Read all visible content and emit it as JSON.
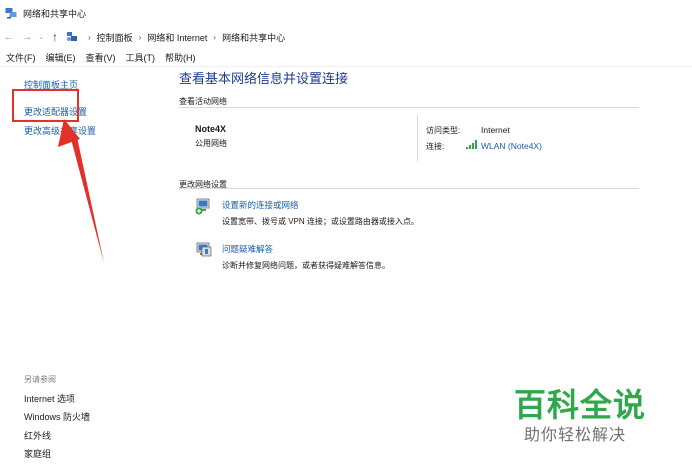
{
  "window": {
    "title": "网络和共享中心",
    "icon": "network-sharing-icon"
  },
  "address": {
    "back_icon": "back-arrow-icon",
    "forward_icon": "forward-arrow-icon",
    "history_icon": "chevron-down-icon",
    "up_icon": "up-arrow-icon",
    "crumbs": [
      "控制面板",
      "网络和 Internet",
      "网络和共享中心"
    ]
  },
  "menu": {
    "items": [
      "文件(F)",
      "编辑(E)",
      "查看(V)",
      "工具(T)",
      "帮助(H)"
    ]
  },
  "sidebar": {
    "links": [
      "控制面板主页",
      "更改适配器设置",
      "更改高级共享设置"
    ],
    "see_also_heading": "另请参阅",
    "see_also": [
      "Internet 选项",
      "Windows 防火墙",
      "红外线",
      "家庭组"
    ]
  },
  "main": {
    "title": "查看基本网络信息并设置连接",
    "active_section": "查看活动网络",
    "network": {
      "name": "Note4X",
      "type": "公用网络",
      "access_label": "访问类型:",
      "access_value": "Internet",
      "conn_label": "连接:",
      "conn_value": "WLAN (Note4X)"
    },
    "change_section": "更改网络设置",
    "tasks": [
      {
        "title": "设置新的连接或网络",
        "desc": "设置宽带、拨号或 VPN 连接；或设置路由器或接入点。",
        "icon": "new-connection-icon"
      },
      {
        "title": "问题疑难解答",
        "desc": "诊断并修复网络问题，或者获得疑难解答信息。",
        "icon": "troubleshoot-icon"
      }
    ]
  },
  "watermark": {
    "brand": "百科全说",
    "slogan": "助你轻松解决"
  },
  "colors": {
    "link": "#1a5ea8",
    "title": "#1e3d8f",
    "highlight": "#e2302a",
    "watermark": "#2ea84a"
  }
}
